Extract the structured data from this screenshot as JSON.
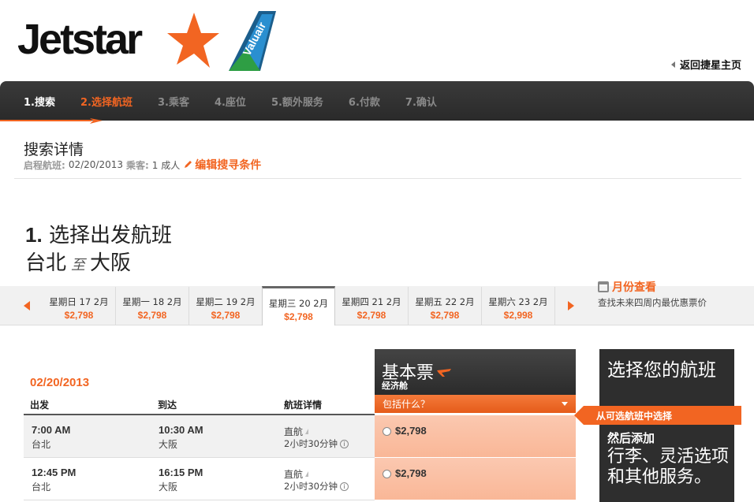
{
  "header": {
    "logo_text": "Jetstar",
    "logo_partner": "Valuair",
    "home_link": "返回捷星主页"
  },
  "steps": [
    {
      "label": "1.搜索",
      "state": "done"
    },
    {
      "label": "2.选择航班",
      "state": "active"
    },
    {
      "label": "3.乘客",
      "state": "todo"
    },
    {
      "label": "4.座位",
      "state": "todo"
    },
    {
      "label": "5.额外服务",
      "state": "todo"
    },
    {
      "label": "6.付款",
      "state": "todo"
    },
    {
      "label": "7.确认",
      "state": "todo"
    }
  ],
  "search": {
    "title": "搜索详情",
    "route_label": "启程航班:",
    "route_date": "02/20/2013",
    "pax_label": "乘客:",
    "pax_value": "1 成人",
    "edit_link": "编辑搜寻条件"
  },
  "heading": {
    "step_num": "1.",
    "step_text": "选择出发航班",
    "origin": "台北",
    "to_word": "至",
    "destination": "大阪"
  },
  "date_strip": {
    "dates": [
      {
        "label": "星期日 17 2月",
        "price": "$2,798",
        "selected": false
      },
      {
        "label": "星期一 18 2月",
        "price": "$2,798",
        "selected": false
      },
      {
        "label": "星期二 19 2月",
        "price": "$2,798",
        "selected": false
      },
      {
        "label": "星期三 20 2月",
        "price": "$2,798",
        "selected": true
      },
      {
        "label": "星期四 21 2月",
        "price": "$2,798",
        "selected": false
      },
      {
        "label": "星期五 22 2月",
        "price": "$2,798",
        "selected": false
      },
      {
        "label": "星期六 23 2月",
        "price": "$2,998",
        "selected": false
      }
    ],
    "month_view_title": "月份查看",
    "month_view_sub": "查找未来四周内最优惠票价"
  },
  "table": {
    "date": "02/20/2013",
    "headers": {
      "depart": "出发",
      "arrive": "到达",
      "details": "航班详情"
    },
    "rows": [
      {
        "dep_time": "7:00 AM",
        "dep_city": "台北",
        "arr_time": "10:30 AM",
        "arr_city": "大阪",
        "type": "直航",
        "duration": "2小时30分钟",
        "fare": "$2,798"
      },
      {
        "dep_time": "12:45 PM",
        "dep_city": "台北",
        "arr_time": "16:15 PM",
        "arr_city": "大阪",
        "type": "直航",
        "duration": "2小时30分钟",
        "fare": "$2,798"
      }
    ]
  },
  "fare_column": {
    "title": "基本票",
    "subtitle": "经济舱",
    "dropdown": "包括什么？"
  },
  "side_panel": {
    "line1": "选择您的航班",
    "tag": "从可选航班中选择",
    "line2": "然后添加",
    "line3": "行李、灵活选项和其他服务。"
  },
  "colors": {
    "accent": "#f26522",
    "dark_bar": "#2e2e2e",
    "fare_bg": "#fbc8b0"
  }
}
